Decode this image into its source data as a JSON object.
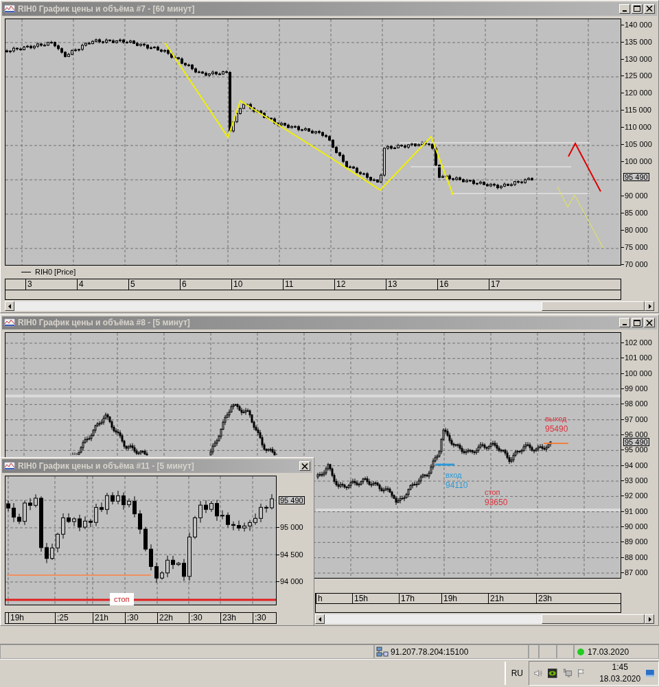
{
  "windows": [
    {
      "kind": "main",
      "title": "RIH0 График цены и объёма #7 - [60 минут]",
      "buttons": [
        {
          "kind": "minimize"
        },
        {
          "kind": "maximize"
        },
        {
          "kind": "close"
        }
      ],
      "y_ticks": [
        "140 000",
        "135 000",
        "130 000",
        "125 000",
        "120 000",
        "115 000",
        "110 000",
        "105 000",
        "100 000",
        "90 000",
        "85 000",
        "80 000",
        "75 000",
        "70 000"
      ],
      "price_tag": "95 490",
      "legend": "RIH0 [Price]",
      "x_ticks": [
        "3",
        "4",
        "5",
        "6",
        "10",
        "11",
        "12",
        "13",
        "16",
        "17"
      ]
    },
    {
      "kind": "main",
      "title": "RIH0 График цены и объёма #8 - [5 минут]",
      "buttons": [
        {
          "kind": "minimize"
        },
        {
          "kind": "maximize"
        },
        {
          "kind": "close"
        }
      ],
      "y_ticks": [
        "102 000",
        "101 000",
        "100 000",
        "99 000",
        "98 000",
        "97 000",
        "96 000",
        "95 000",
        "94 000",
        "93 000",
        "92 000",
        "91 000",
        "90 000",
        "89 000",
        "88 000",
        "87 000"
      ],
      "price_tag": "95 490",
      "x_ticks": [
        "h",
        "15h",
        "17h",
        "19h",
        "21h",
        "23h"
      ],
      "annotations": [
        {
          "label": "выход",
          "value": "95490",
          "color": "#e0303c"
        },
        {
          "label": "вход",
          "value": "94110",
          "color": "#2a9ad8"
        },
        {
          "label": "стоп",
          "value": "93650",
          "color": "#e0303c"
        }
      ]
    },
    {
      "kind": "popup",
      "title": "RIH0 График цены и объёма #11 - [5 минут]",
      "buttons": [
        {
          "kind": "close"
        }
      ],
      "y_ticks": [
        "95 000",
        "94 500",
        "94 000"
      ],
      "price_tag": "95 490",
      "stop_label": "стоп",
      "x_ticks": [
        "19h",
        ":25",
        "21h",
        ":30",
        "22h",
        ":30",
        "23h",
        ":30"
      ]
    }
  ],
  "status_bar": {
    "address": "91.207.78.204:15100",
    "connected": true,
    "date": "17.03.2020"
  },
  "taskbar": {
    "language": "RU",
    "time": "1:45",
    "date": "18.03.2020"
  }
}
